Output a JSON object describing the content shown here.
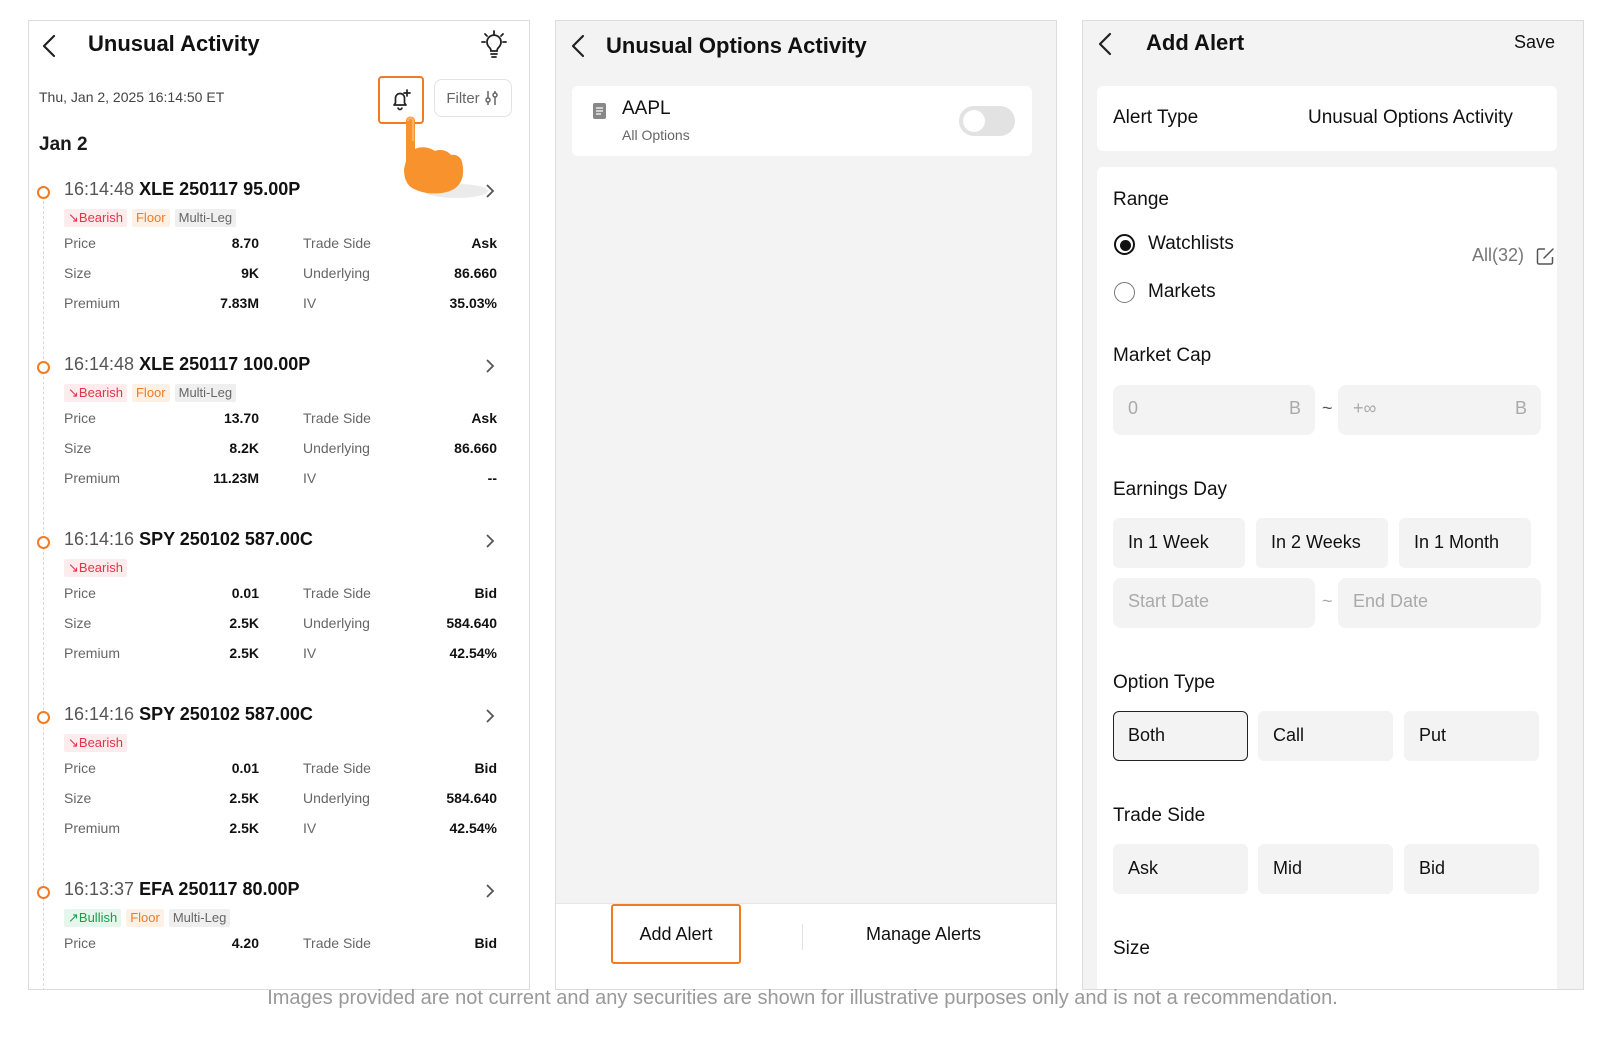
{
  "screen1": {
    "title": "Unusual Activity",
    "datetime": "Thu, Jan 2, 2025 16:14:50 ET",
    "filter_label": "Filter",
    "day_label": "Jan 2",
    "labels": {
      "price": "Price",
      "size": "Size",
      "premium": "Premium",
      "trade_side": "Trade Side",
      "underlying": "Underlying",
      "iv": "IV"
    },
    "entries": [
      {
        "time": "16:14:48",
        "symbol": "XLE 250117 95.00P",
        "sentiment": "Bearish",
        "floor": "Floor",
        "multi": "Multi-Leg",
        "price": "8.70",
        "size": "9K",
        "premium": "7.83M",
        "trade_side": "Ask",
        "underlying": "86.660",
        "iv": "35.03%"
      },
      {
        "time": "16:14:48",
        "symbol": "XLE 250117 100.00P",
        "sentiment": "Bearish",
        "floor": "Floor",
        "multi": "Multi-Leg",
        "price": "13.70",
        "size": "8.2K",
        "premium": "11.23M",
        "trade_side": "Ask",
        "underlying": "86.660",
        "iv": "--"
      },
      {
        "time": "16:14:16",
        "symbol": "SPY 250102 587.00C",
        "sentiment": "Bearish",
        "floor": "",
        "multi": "",
        "price": "0.01",
        "size": "2.5K",
        "premium": "2.5K",
        "trade_side": "Bid",
        "underlying": "584.640",
        "iv": "42.54%"
      },
      {
        "time": "16:14:16",
        "symbol": "SPY 250102 587.00C",
        "sentiment": "Bearish",
        "floor": "",
        "multi": "",
        "price": "0.01",
        "size": "2.5K",
        "premium": "2.5K",
        "trade_side": "Bid",
        "underlying": "584.640",
        "iv": "42.54%"
      },
      {
        "time": "16:13:37",
        "symbol": "EFA 250117 80.00P",
        "sentiment": "Bullish",
        "floor": "Floor",
        "multi": "Multi-Leg",
        "price": "4.20",
        "trade_side": "Bid"
      }
    ]
  },
  "screen2": {
    "title": "Unusual Options Activity",
    "item_symbol": "AAPL",
    "item_sub": "All Options",
    "add_alert": "Add Alert",
    "manage_alerts": "Manage Alerts"
  },
  "screen3": {
    "title": "Add Alert",
    "save": "Save",
    "alert_type_label": "Alert Type",
    "alert_type_value": "Unusual Options Activity",
    "range_label": "Range",
    "watchlists": "Watchlists",
    "watchlists_value": "All(32)",
    "markets": "Markets",
    "market_cap_label": "Market Cap",
    "mc_min": "0",
    "mc_max": "+∞",
    "mc_unit": "B",
    "tilde": "~",
    "earnings_label": "Earnings Day",
    "earnings_options": [
      "In 1 Week",
      "In 2 Weeks",
      "In 1 Month"
    ],
    "start_date": "Start Date",
    "end_date": "End Date",
    "option_type_label": "Option Type",
    "option_types": [
      "Both",
      "Call",
      "Put"
    ],
    "trade_side_label": "Trade Side",
    "trade_sides": [
      "Ask",
      "Mid",
      "Bid"
    ],
    "size_label": "Size"
  },
  "disclaimer": "Images provided are not current and any securities are shown for illustrative purposes only and is not a recommendation.",
  "colors": {
    "accent": "#f07b22",
    "bearish": "#e2344a",
    "bullish": "#1c9b50"
  }
}
